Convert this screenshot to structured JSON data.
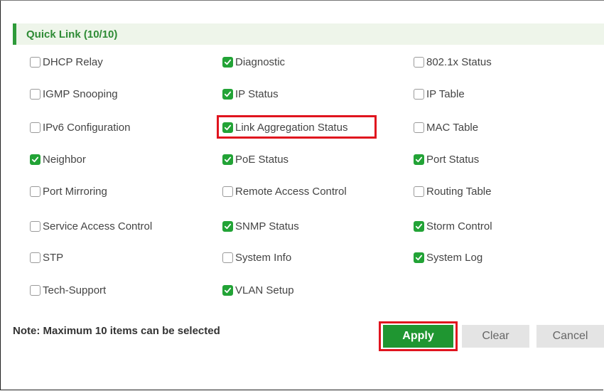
{
  "header": {
    "title": "Quick Link (10/10)"
  },
  "items": [
    {
      "label": "DHCP Relay",
      "checked": false
    },
    {
      "label": "Diagnostic",
      "checked": true
    },
    {
      "label": "802.1x Status",
      "checked": false
    },
    {
      "label": "IGMP Snooping",
      "checked": false
    },
    {
      "label": "IP Status",
      "checked": true
    },
    {
      "label": "IP Table",
      "checked": false
    },
    {
      "label": "IPv6 Configuration",
      "checked": false
    },
    {
      "label": "Link Aggregation Status",
      "checked": true
    },
    {
      "label": "MAC Table",
      "checked": false
    },
    {
      "label": "Neighbor",
      "checked": true
    },
    {
      "label": "PoE Status",
      "checked": true
    },
    {
      "label": "Port Status",
      "checked": true
    },
    {
      "label": "Port Mirroring",
      "checked": false
    },
    {
      "label": "Remote Access Control",
      "checked": false
    },
    {
      "label": "Routing Table",
      "checked": false
    },
    {
      "label": "Service Access Control",
      "checked": false
    },
    {
      "label": "SNMP Status",
      "checked": true
    },
    {
      "label": "Storm Control",
      "checked": true
    },
    {
      "label": "STP",
      "checked": false
    },
    {
      "label": "System Info",
      "checked": false
    },
    {
      "label": "System Log",
      "checked": true
    },
    {
      "label": "Tech-Support",
      "checked": false
    },
    {
      "label": "VLAN Setup",
      "checked": true
    }
  ],
  "note": "Note: Maximum 10 items can be selected",
  "buttons": {
    "apply": "Apply",
    "clear": "Clear",
    "cancel": "Cancel"
  },
  "colors": {
    "accent": "#22a336",
    "highlight": "#e0141e",
    "header_bg": "#eef5ea"
  }
}
